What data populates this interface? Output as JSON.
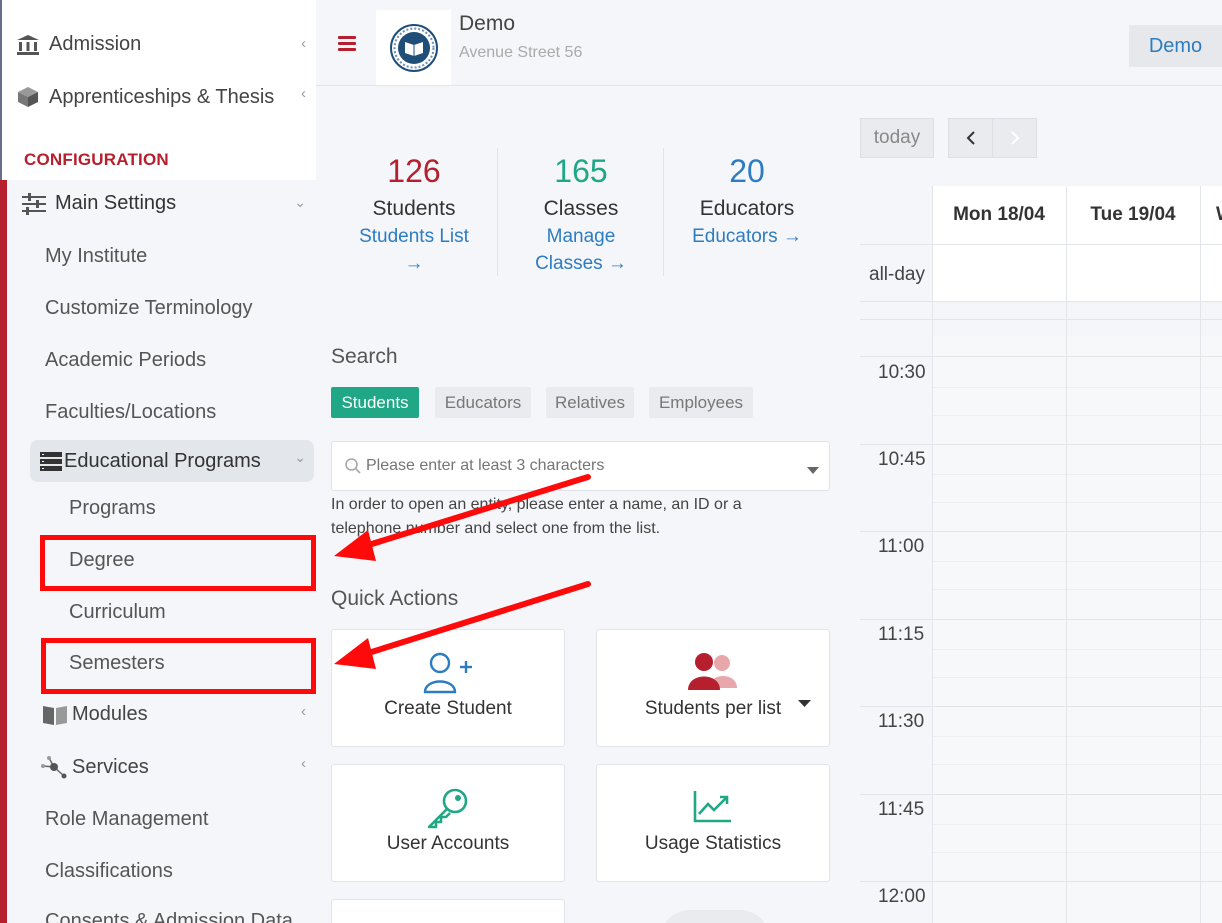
{
  "sidebar": {
    "items_top": [
      {
        "label": "Admission",
        "icon": "bank-icon"
      },
      {
        "label": "Apprenticeships & Thesis",
        "icon": "cube-icon"
      }
    ],
    "section_title": "CONFIGURATION",
    "main_settings": "Main Settings",
    "main_children": [
      "My Institute",
      "Customize Terminology",
      "Academic Periods",
      "Faculties/Locations"
    ],
    "educational_programs": "Educational Programs",
    "ep_children": [
      "Programs",
      "Degree",
      "Curriculum",
      "Semesters"
    ],
    "modules": "Modules",
    "services": "Services",
    "bottom_items": [
      "Role Management",
      "Classifications",
      "Consents & Admission Data"
    ]
  },
  "header": {
    "institute_name": "Demo",
    "institute_address": "Avenue Street 56",
    "user_button": "Demo"
  },
  "stats": {
    "students": {
      "value": "126",
      "label": "Students",
      "link_line1": "Students List",
      "link_line2": "→"
    },
    "classes": {
      "value": "165",
      "label": "Classes",
      "link_line1": "Manage",
      "link_line2": "Classes  →"
    },
    "educators": {
      "value": "20",
      "label": "Educators",
      "link_line1": "Educators  →"
    }
  },
  "search": {
    "title": "Search",
    "tabs": [
      "Students",
      "Educators",
      "Relatives",
      "Employees"
    ],
    "placeholder": "Please enter at least 3 characters",
    "help": "In order to open an entity, please enter a name, an ID or a telephone number and select one from the list."
  },
  "quick_actions": {
    "title": "Quick Actions",
    "cards": [
      "Create Student",
      "Students per list",
      "User Accounts",
      "Usage Statistics"
    ]
  },
  "calendar": {
    "today": "today",
    "days": [
      "Mon 18/04",
      "Tue 19/04"
    ],
    "all_day": "all-day",
    "times": [
      "10:30",
      "10:45",
      "11:00",
      "11:15",
      "11:30",
      "11:45",
      "12:00"
    ]
  },
  "colors": {
    "brand_red": "#b6202e",
    "accent_green": "#1fa786",
    "link_blue": "#2d7cc2",
    "annotation_red": "#ff0a0a"
  }
}
